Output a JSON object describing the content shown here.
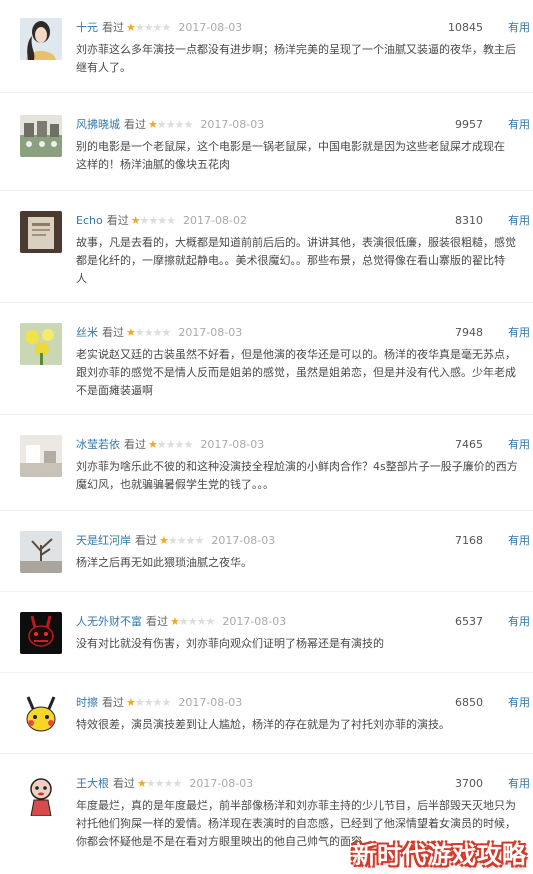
{
  "watched_label": "看过",
  "useful_label": "有用",
  "reviews": [
    {
      "user": "十元",
      "stars": 1,
      "date": "2017-08-03",
      "votes": "10845",
      "text": "刘亦菲这么多年演技一点都没有进步啊；杨洋完美的呈现了一个油腻又装逼的夜华，教主后\n继有人了。"
    },
    {
      "user": "风拂晓城",
      "stars": 1,
      "date": "2017-08-03",
      "votes": "9957",
      "text": "别的电影是一个老鼠屎，这个电影是一锅老鼠屎，中国电影就是因为这些老鼠屎才成现在\n这样的！杨洋油腻的像块五花肉"
    },
    {
      "user": "Echo",
      "stars": 1,
      "date": "2017-08-02",
      "votes": "8310",
      "text": "故事，凡是去看的，大概都是知道前前后后的。讲讲其他，表演很低廉，服装很粗糙，感觉\n都是化纤的，一摩擦就起静电。。美术很魔幻。。那些布景，总觉得像在看山寨版的翟比特\n人"
    },
    {
      "user": "丝米",
      "stars": 1,
      "date": "2017-08-03",
      "votes": "7948",
      "text": "老实说赵又廷的古装虽然不好看，但是他演的夜华还是可以的。杨洋的夜华真是毫无苏点，\n跟刘亦菲的感觉不是情人反而是姐弟的感觉，虽然是姐弟恋，但是并没有代入感。少年老成\n不是面瘫装逼啊"
    },
    {
      "user": "冰莹若依",
      "stars": 1,
      "date": "2017-08-03",
      "votes": "7465",
      "text": "刘亦菲为啥乐此不彼的和这种没演技全程尬演的小鲜肉合作？4s整部片子一股子廉价的西方\n魔幻风，也就骗骗暑假学生党的钱了。。。"
    },
    {
      "user": "天是红河岸",
      "stars": 1,
      "date": "2017-08-03",
      "votes": "7168",
      "text": "杨洋之后再无如此猥琐油腻之夜华。"
    },
    {
      "user": "人无外财不富",
      "stars": 1,
      "date": "2017-08-03",
      "votes": "6537",
      "text": "没有对比就没有伤害，刘亦菲向观众们证明了杨幂还是有演技的"
    },
    {
      "user": "时擦",
      "stars": 1,
      "date": "2017-08-03",
      "votes": "6850",
      "text": "特效很差，演员演技差到让人尴尬，杨洋的存在就是为了衬托刘亦菲的演技。"
    },
    {
      "user": "王大根",
      "stars": 1,
      "date": "2017-08-03",
      "votes": "3700",
      "text": "年度最烂，真的是年度最烂，前半部像杨洋和刘亦菲主持的少儿节目，后半部毁天灭地只为\n衬托他们狗屎一样的爱情。杨洋现在表演时的自恋感，已经到了他深情望着女演员的时候，\n你都会怀疑他是不是在看对方眼里映出的他自己帅气的面容"
    }
  ],
  "watermark": "新时代游戏攻略"
}
